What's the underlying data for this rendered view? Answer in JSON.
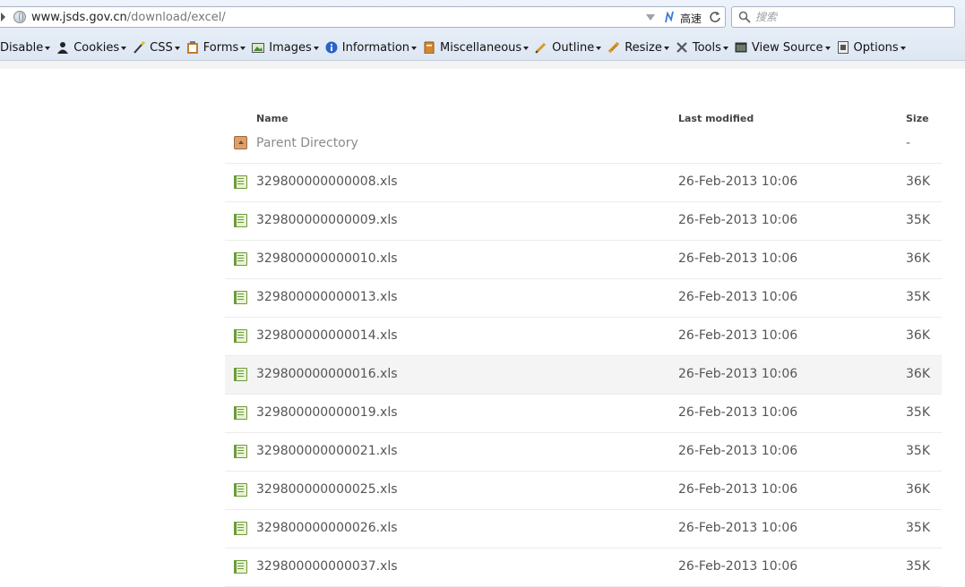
{
  "browser": {
    "url_host": "www.jsds.gov.cn",
    "url_path": "/download/excel/",
    "speed_label": "高速",
    "search_placeholder": "搜索"
  },
  "toolbar": {
    "items": [
      {
        "label": "Disable",
        "icon": "disable-icon"
      },
      {
        "label": "Cookies",
        "icon": "cookie-icon"
      },
      {
        "label": "CSS",
        "icon": "css-wand-icon"
      },
      {
        "label": "Forms",
        "icon": "clipboard-icon"
      },
      {
        "label": "Images",
        "icon": "image-icon"
      },
      {
        "label": "Information",
        "icon": "info-icon"
      },
      {
        "label": "Miscellaneous",
        "icon": "misc-icon"
      },
      {
        "label": "Outline",
        "icon": "pencil-icon"
      },
      {
        "label": "Resize",
        "icon": "ruler-icon"
      },
      {
        "label": "Tools",
        "icon": "tools-icon"
      },
      {
        "label": "View Source",
        "icon": "source-icon"
      },
      {
        "label": "Options",
        "icon": "options-icon"
      }
    ]
  },
  "listing": {
    "columns": {
      "name": "Name",
      "modified": "Last modified",
      "size": "Size"
    },
    "parent": {
      "name": "Parent Directory",
      "size": "-"
    },
    "rows": [
      {
        "name": "329800000000008.xls",
        "modified": "26-Feb-2013 10:06",
        "size": "36K"
      },
      {
        "name": "329800000000009.xls",
        "modified": "26-Feb-2013 10:06",
        "size": "35K"
      },
      {
        "name": "329800000000010.xls",
        "modified": "26-Feb-2013 10:06",
        "size": "36K"
      },
      {
        "name": "329800000000013.xls",
        "modified": "26-Feb-2013 10:06",
        "size": "35K"
      },
      {
        "name": "329800000000014.xls",
        "modified": "26-Feb-2013 10:06",
        "size": "36K"
      },
      {
        "name": "329800000000016.xls",
        "modified": "26-Feb-2013 10:06",
        "size": "36K"
      },
      {
        "name": "329800000000019.xls",
        "modified": "26-Feb-2013 10:06",
        "size": "35K"
      },
      {
        "name": "329800000000021.xls",
        "modified": "26-Feb-2013 10:06",
        "size": "35K"
      },
      {
        "name": "329800000000025.xls",
        "modified": "26-Feb-2013 10:06",
        "size": "36K"
      },
      {
        "name": "329800000000026.xls",
        "modified": "26-Feb-2013 10:06",
        "size": "35K"
      },
      {
        "name": "329800000000037.xls",
        "modified": "26-Feb-2013 10:06",
        "size": "35K"
      }
    ]
  }
}
